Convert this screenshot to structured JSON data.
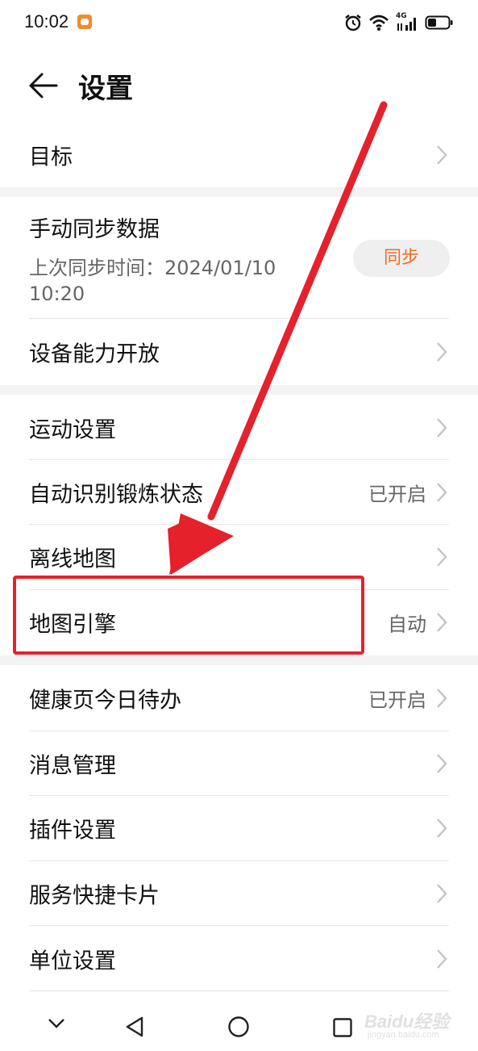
{
  "status_bar": {
    "time": "10:02",
    "network": "4G"
  },
  "header": {
    "title": "设置"
  },
  "section1": {
    "goal": "目标"
  },
  "sync": {
    "title": "手动同步数据",
    "subtitle": "上次同步时间：2024/01/10 10:20",
    "button_label": "同步"
  },
  "section2": {
    "device_capability": "设备能力开放"
  },
  "section3": {
    "sport_settings": "运动设置",
    "auto_detect": {
      "label": "自动识别锻炼状态",
      "value": "已开启"
    },
    "offline_map": "离线地图",
    "map_engine": {
      "label": "地图引擎",
      "value": "自动"
    }
  },
  "section4": {
    "health_todo": {
      "label": "健康页今日待办",
      "value": "已开启"
    },
    "message_mgmt": "消息管理",
    "plugin_settings": "插件设置",
    "service_cards": "服务快捷卡片",
    "unit_settings": "单位设置"
  },
  "watermark": {
    "brand": "Baidu经验",
    "url": "jingyan.baidu.com"
  },
  "colors": {
    "accent": "#f06d1f",
    "annotation_red": "#e5212b",
    "section_gap": "#f3f3f3"
  }
}
